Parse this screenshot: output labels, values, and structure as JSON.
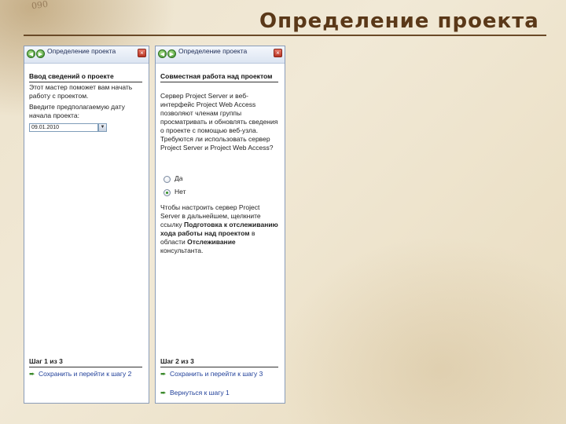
{
  "slide": {
    "title": "Определение проекта",
    "background_text": "090"
  },
  "colors": {
    "title": "#5a3818",
    "pane_header": "#dce5f2",
    "link": "#1f3f99",
    "nav_button": "#3a8d2a",
    "close_button": "#b83322"
  },
  "left_pane": {
    "header_title": "Определение проекта",
    "close_label": "×",
    "back_icon": "back-arrow-icon",
    "forward_icon": "forward-arrow-icon",
    "section_heading": "Ввод сведений о проекте",
    "intro_text": "Этот мастер поможет вам начать работу с проектом.",
    "prompt_text": "Введите предполагаемую дату начала проекта:",
    "date_value": "09.01.2010",
    "date_dropdown": "▼",
    "step_label": "Шаг 1 из 3",
    "save_next_label": "Сохранить и перейти к шагу 2"
  },
  "right_pane": {
    "header_title": "Определение проекта",
    "close_label": "×",
    "section_heading": "Совместная работа над проектом",
    "question_text": "Сервер Project Server и веб-интерфейс Project Web Access позволяют членам группы просматривать и обновлять сведения о проекте с помощью веб-узла. Требуются ли использовать сервер Project Server и Project Web Access?",
    "radio_yes": "Да",
    "radio_no": "Нет",
    "selected": "Нет",
    "hint_start": "Чтобы настроить сервер Project Server в дальнейшем, щелкните ссылку",
    "hint_link": "Подготовка к отслеживанию хода работы над проектом",
    "hint_mid": "в области",
    "hint_area": "Отслеживание",
    "hint_end": "консультанта.",
    "step_label": "Шаг 2 из 3",
    "save_next_label": "Сохранить и перейти к шагу 3",
    "back_label": "Вернуться к шагу 1"
  }
}
